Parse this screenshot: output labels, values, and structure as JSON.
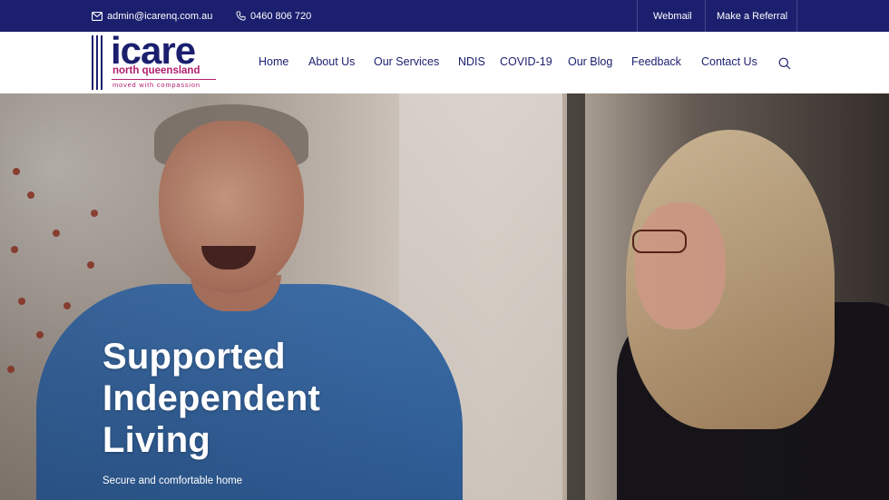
{
  "topbar": {
    "email": "admin@icarenq.com.au",
    "phone": "0460 806 720",
    "webmail": "Webmail",
    "referral": "Make a Referral",
    "background": "#1b1f6e"
  },
  "logo": {
    "word": "icare",
    "subtitle": "north queensland",
    "tagline": "moved with compassion",
    "primary_color": "#1b1f6e",
    "accent_color": "#b01f6e"
  },
  "nav": {
    "items": [
      "Home",
      "About Us",
      "Our Services",
      "NDIS",
      "COVID-19",
      "Our Blog",
      "Feedback",
      "Contact Us"
    ],
    "search_icon": "search-icon"
  },
  "hero": {
    "heading_lines": [
      "Supported",
      "Independent",
      "Living"
    ],
    "subtext": "Secure and comfortable home"
  }
}
